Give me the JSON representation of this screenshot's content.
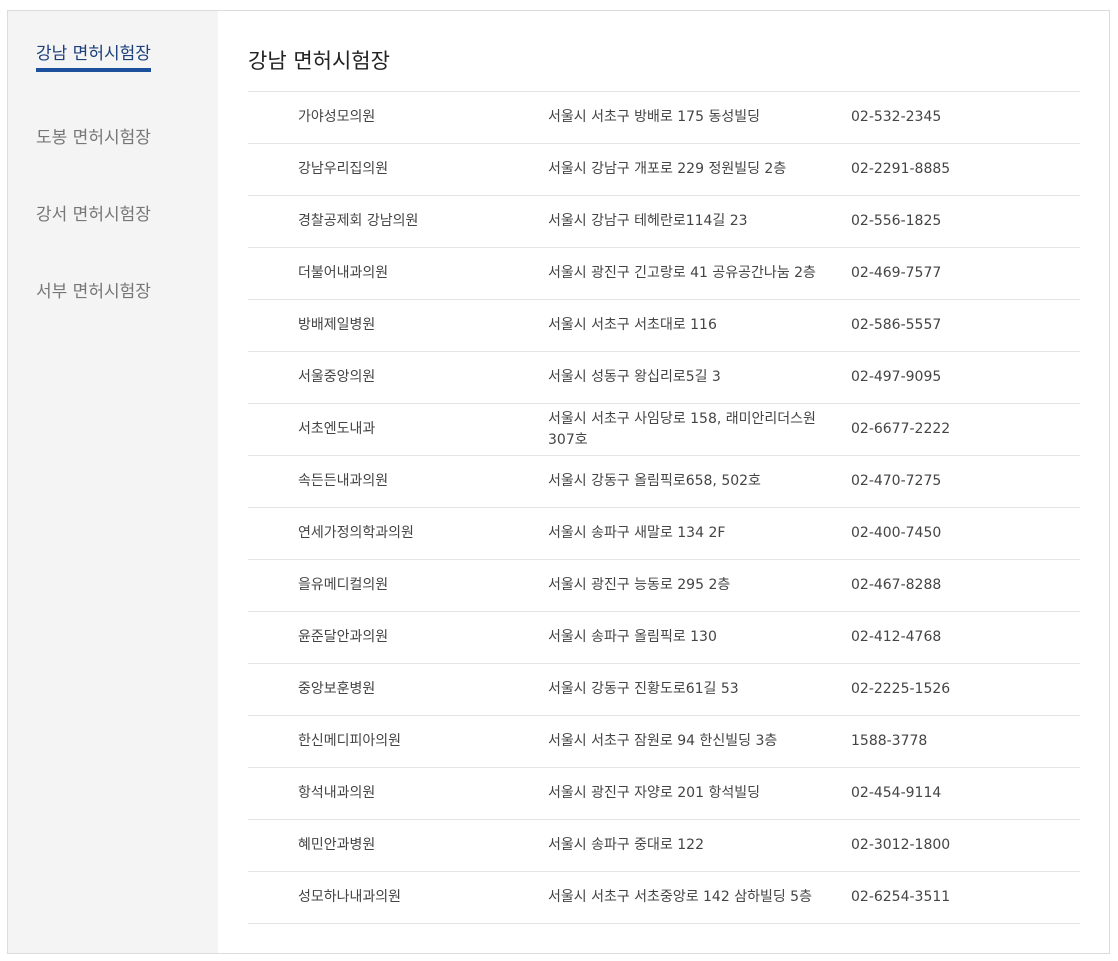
{
  "sidebar": {
    "items": [
      {
        "label": "강남 면허시험장",
        "active": true
      },
      {
        "label": "도봉 면허시험장",
        "active": false
      },
      {
        "label": "강서 면허시험장",
        "active": false
      },
      {
        "label": "서부 면허시험장",
        "active": false
      }
    ]
  },
  "main": {
    "title": "강남 면허시험장",
    "rows": [
      {
        "name": "가야성모의원",
        "address": "서울시 서초구 방배로 175 동성빌딩",
        "phone": "02-532-2345"
      },
      {
        "name": "강남우리집의원",
        "address": "서울시 강남구 개포로 229 정원빌딩 2층",
        "phone": "02-2291-8885"
      },
      {
        "name": "경찰공제회 강남의원",
        "address": "서울시 강남구 테헤란로114길 23",
        "phone": "02-556-1825"
      },
      {
        "name": "더불어내과의원",
        "address": "서울시 광진구 긴고랑로 41 공유공간나눔 2층",
        "phone": "02-469-7577"
      },
      {
        "name": "방배제일병원",
        "address": "서울시 서초구 서초대로 116",
        "phone": "02-586-5557"
      },
      {
        "name": "서울중앙의원",
        "address": "서울시 성동구 왕십리로5길 3",
        "phone": "02-497-9095"
      },
      {
        "name": "서초엔도내과",
        "address": "서울시 서초구 사임당로 158, 래미안리더스원 307호",
        "phone": "02-6677-2222"
      },
      {
        "name": "속든든내과의원",
        "address": "서울시 강동구 올림픽로658, 502호",
        "phone": "02-470-7275"
      },
      {
        "name": "연세가정의학과의원",
        "address": "서울시 송파구 새말로 134 2F",
        "phone": "02-400-7450"
      },
      {
        "name": "을유메디컬의원",
        "address": "서울시 광진구 능동로 295 2층",
        "phone": "02-467-8288"
      },
      {
        "name": "윤준달안과의원",
        "address": "서울시 송파구 올림픽로 130",
        "phone": "02-412-4768"
      },
      {
        "name": "중앙보훈병원",
        "address": "서울시 강동구 진황도로61길 53",
        "phone": "02-2225-1526"
      },
      {
        "name": "한신메디피아의원",
        "address": "서울시 서초구 잠원로 94 한신빌딩 3층",
        "phone": "1588-3778"
      },
      {
        "name": "항석내과의원",
        "address": "서울시 광진구 자양로 201 항석빌딩",
        "phone": "02-454-9114"
      },
      {
        "name": "혜민안과병원",
        "address": "서울시 송파구 중대로 122",
        "phone": "02-3012-1800"
      },
      {
        "name": "성모하나내과의원",
        "address": "서울시 서초구 서초중앙로 142 삼하빌딩 5층",
        "phone": "02-6254-3511"
      }
    ]
  }
}
